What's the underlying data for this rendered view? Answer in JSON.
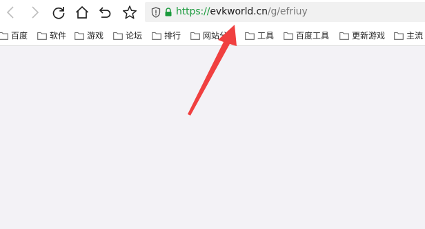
{
  "browser": {
    "icons": {
      "back": "back-arrow-icon",
      "forward": "forward-arrow-icon",
      "reload": "reload-icon",
      "home": "home-icon",
      "undo": "undo-icon",
      "favorite": "star-icon",
      "security": "shield-icon",
      "lock": "lock-icon"
    },
    "address": {
      "scheme": "https://",
      "host": "evkworld.cn",
      "path": "/g/efriuy"
    },
    "colors": {
      "scheme": "#1a9a3c",
      "lock": "#1a9a3c",
      "annotation_arrow": "#f04040"
    }
  },
  "bookmarks": [
    {
      "label": "百度"
    },
    {
      "label": "软件"
    },
    {
      "label": "游戏"
    },
    {
      "label": "论坛"
    },
    {
      "label": "排行"
    },
    {
      "label": "网站分"
    },
    {
      "label": "工具"
    },
    {
      "label": "百度工具"
    },
    {
      "label": "更新游戏"
    },
    {
      "label": "主流"
    }
  ]
}
